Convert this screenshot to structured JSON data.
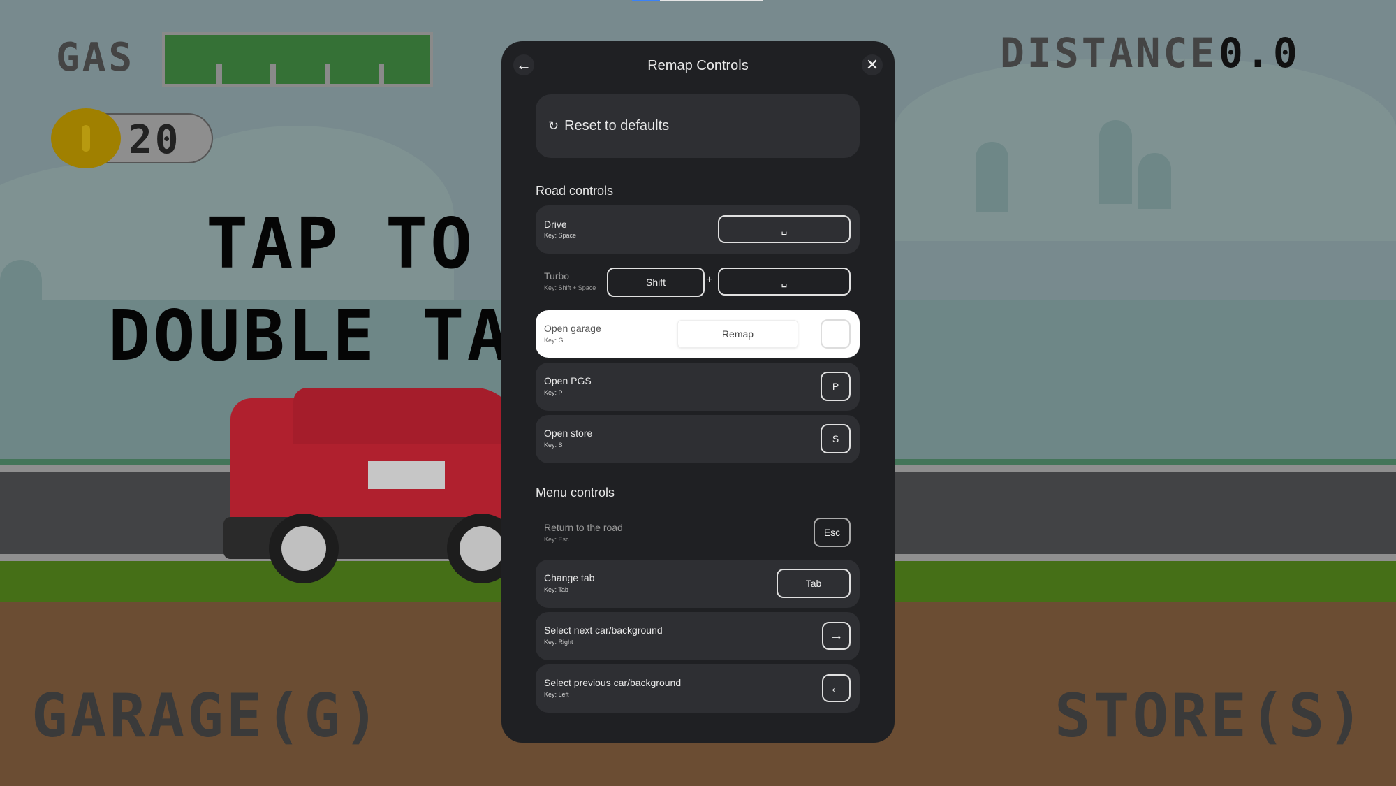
{
  "hud": {
    "gas_label": "GAS",
    "gas_level_percent": 100,
    "coins": "20",
    "distance_label": "DISTANCE",
    "distance_value": "0.0"
  },
  "game_text": {
    "line1": "TAP TO D",
    "line2": "DOUBLE TAP",
    "garage": "GARAGE(G)",
    "store": "STORE(S)"
  },
  "dialog": {
    "title": "Remap Controls",
    "reset_label": "Reset to defaults",
    "sections": [
      {
        "title": "Road controls",
        "rows": [
          {
            "label": "Drive",
            "sub": "Key: Space",
            "keys": [
              "␣"
            ]
          },
          {
            "label": "Turbo",
            "sub": "Key: Shift + Space",
            "keys": [
              "Shift",
              "␣"
            ],
            "joiner": "+"
          },
          {
            "label": "Open garage",
            "sub": "Key: G",
            "remap": "Remap",
            "keys": [
              ""
            ]
          },
          {
            "label": "Open PGS",
            "sub": "Key: P",
            "keys": [
              "P"
            ]
          },
          {
            "label": "Open store",
            "sub": "Key: S",
            "keys": [
              "S"
            ]
          }
        ]
      },
      {
        "title": "Menu controls",
        "rows": [
          {
            "label": "Return to the road",
            "sub": "Key: Esc",
            "keys": [
              "Esc"
            ]
          },
          {
            "label": "Change tab",
            "sub": "Key: Tab",
            "keys": [
              "Tab"
            ]
          },
          {
            "label": "Select next car/background",
            "sub": "Key: Right",
            "keys": [
              "→"
            ]
          },
          {
            "label": "Select previous car/background",
            "sub": "Key: Left",
            "keys": [
              "←"
            ]
          }
        ]
      }
    ]
  },
  "colors": {
    "overlay_bg": "#788a8e",
    "dialog_bg": "#1f2023",
    "row_bg": "#2e2f33",
    "gas_green": "#357136",
    "coin": "#a08000"
  }
}
